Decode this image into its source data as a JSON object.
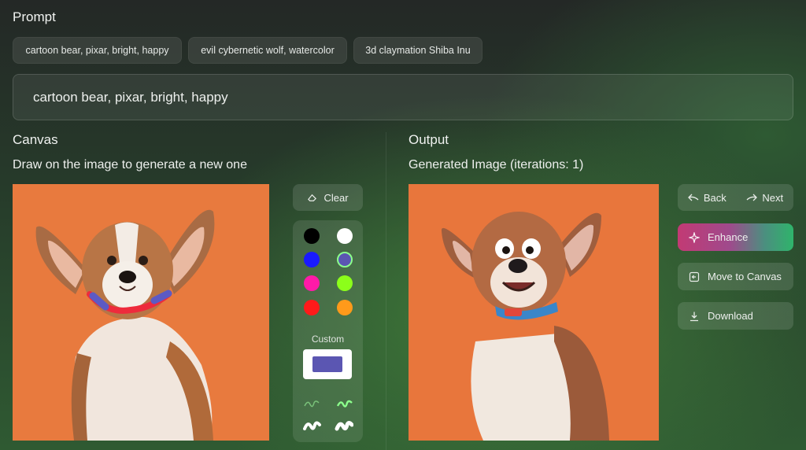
{
  "prompt": {
    "title": "Prompt",
    "suggestions": [
      "cartoon bear, pixar, bright, happy",
      "evil cybernetic wolf, watercolor",
      "3d claymation Shiba Inu"
    ],
    "value": "cartoon bear, pixar, bright, happy"
  },
  "canvas": {
    "title": "Canvas",
    "subtitle": "Draw on the image to generate a new one",
    "clear_label": "Clear",
    "custom_label": "Custom",
    "colors": [
      "#000000",
      "#ffffff",
      "#1a1aff",
      "#5b56b2",
      "#ff1aa8",
      "#8cff1a",
      "#ff1a1a",
      "#ff9a1a"
    ],
    "custom_color": "#5b56b2"
  },
  "output": {
    "title": "Output",
    "subtitle": "Generated Image (iterations: 1)",
    "back_label": "Back",
    "next_label": "Next",
    "enhance_label": "Enhance",
    "move_label": "Move to Canvas",
    "download_label": "Download"
  }
}
